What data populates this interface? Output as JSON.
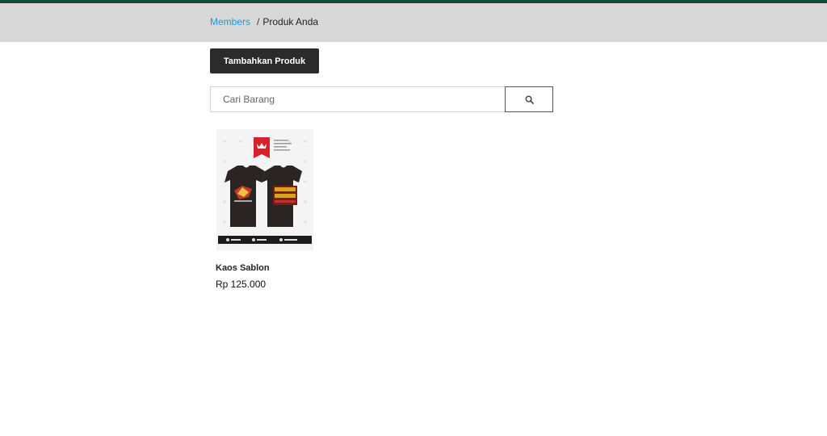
{
  "breadcrumb": {
    "parent_label": "Members",
    "separator": "/",
    "current_label": "Produk Anda"
  },
  "toolbar": {
    "add_product_label": "Tambahkan Produk"
  },
  "search": {
    "placeholder": "Cari Barang",
    "value": ""
  },
  "products": [
    {
      "name": "Kaos Sablon",
      "price": "Rp 125.000",
      "image_icon": "tshirt-product-image"
    }
  ],
  "colors": {
    "topbar": "#0e4d3c",
    "breadcrumb_bg": "#d8d8d8",
    "link": "#1a9ad6",
    "button_bg": "#2b2b2b"
  }
}
